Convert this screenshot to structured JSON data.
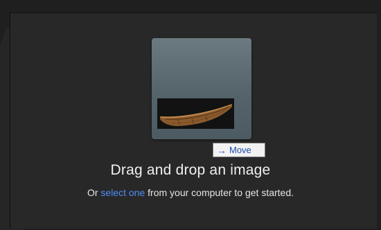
{
  "dropzone": {
    "tooltip_label": "Move",
    "title": "Drag and drop an image",
    "subtitle_prefix": "Or ",
    "subtitle_link": "select one",
    "subtitle_suffix": " from your computer to get started."
  },
  "icons": {
    "move_arrow": "arrow-right-icon",
    "thumbnail": "boat-image"
  },
  "colors": {
    "background": "#1f1f1f",
    "panel": "#282828",
    "card": "#5e6d74",
    "link": "#4f8df6",
    "tooltip_text": "#1f4fa8"
  }
}
